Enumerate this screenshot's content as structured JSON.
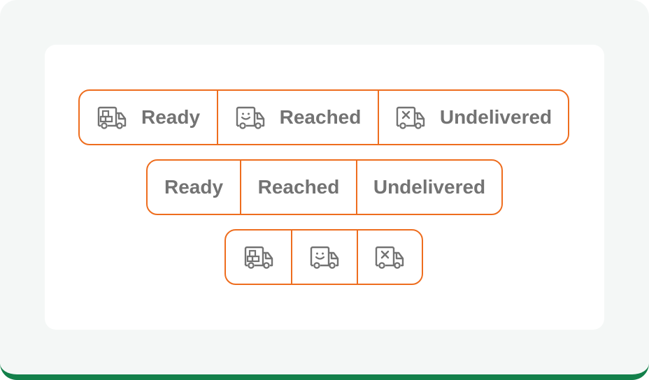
{
  "segmented_controls": {
    "icon_and_label": [
      {
        "label": "Ready",
        "icon": "truck-boxes-icon"
      },
      {
        "label": "Reached",
        "icon": "truck-smile-icon"
      },
      {
        "label": "Undelivered",
        "icon": "truck-x-icon"
      }
    ],
    "label_only": [
      {
        "label": "Ready"
      },
      {
        "label": "Reached"
      },
      {
        "label": "Undelivered"
      }
    ],
    "icon_only": [
      {
        "icon": "truck-boxes-icon"
      },
      {
        "icon": "truck-smile-icon"
      },
      {
        "icon": "truck-x-icon"
      }
    ]
  },
  "colors": {
    "accent": "#ee6d1e",
    "text": "#737373",
    "bottom_bar": "#13804a",
    "backdrop": "#f4f7f6"
  }
}
